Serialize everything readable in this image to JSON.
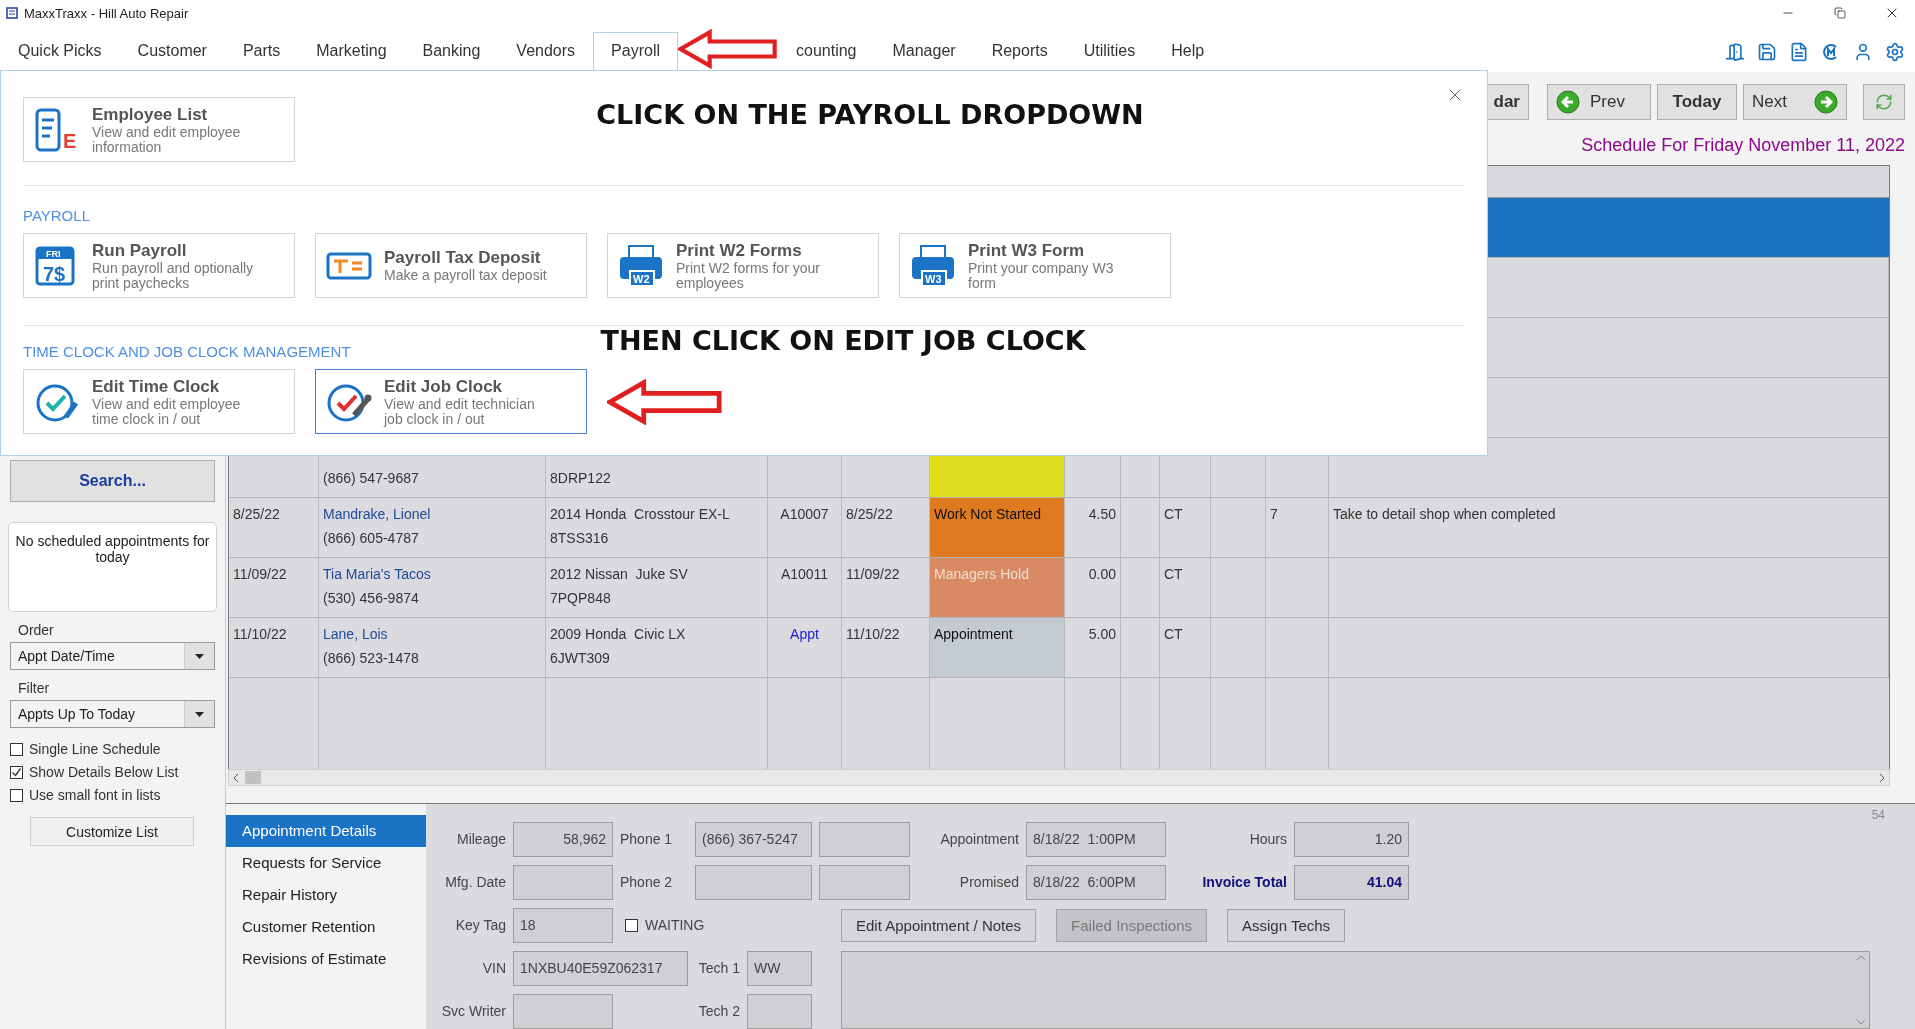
{
  "window": {
    "title": "MaxxTraxx - Hill Auto Repair"
  },
  "menu": [
    {
      "label": "Quick Picks",
      "selected": false
    },
    {
      "label": "Customer",
      "selected": false
    },
    {
      "label": "Parts",
      "selected": false
    },
    {
      "label": "Marketing",
      "selected": false
    },
    {
      "label": "Banking",
      "selected": false
    },
    {
      "label": "Vendors",
      "selected": false
    },
    {
      "label": "Payroll",
      "selected": true
    },
    {
      "label": "counting",
      "selected": false
    },
    {
      "label": "Manager",
      "selected": false
    },
    {
      "label": "Reports",
      "selected": false
    },
    {
      "label": "Utilities",
      "selected": false
    },
    {
      "label": "Help",
      "selected": false
    }
  ],
  "payroll_menu": {
    "top": {
      "note": "CLICK ON THE PAYROLL DROPDOWN",
      "tiles": [
        {
          "title": "Employee List",
          "description": "View and edit employee information",
          "icon_text": [
            "E"
          ],
          "selected": false
        }
      ]
    },
    "sections": [
      {
        "heading": "PAYROLL",
        "tiles": [
          {
            "title": "Run Payroll",
            "description": "Run payroll and optionally print paychecks",
            "icon_text": [
              "FRI",
              "7$"
            ],
            "selected": false
          },
          {
            "title": "Payroll Tax Deposit",
            "description": "Make a payroll tax deposit",
            "selected": false
          },
          {
            "title": "Print W2 Forms",
            "description": "Print W2 forms for your employees",
            "icon_text": [
              "W2"
            ],
            "selected": false
          },
          {
            "title": "Print W3 Form",
            "description": "Print your company W3 form",
            "icon_text": [
              "W3"
            ],
            "selected": false
          }
        ]
      },
      {
        "heading": "TIME CLOCK AND JOB CLOCK MANAGEMENT",
        "note": "THEN CLICK ON EDIT JOB CLOCK",
        "tiles": [
          {
            "title": "Edit Time Clock",
            "description": "View and edit employee time clock in / out",
            "selected": false
          },
          {
            "title": "Edit Job Clock",
            "description": "View and edit technician job clock in / out",
            "selected": true
          }
        ]
      }
    ]
  },
  "toolbar": [
    {
      "kind": "plain",
      "label": "dar"
    },
    {
      "kind": "prev",
      "label": "Prev"
    },
    {
      "kind": "today",
      "label": "Today"
    },
    {
      "kind": "next",
      "label": "Next"
    },
    {
      "kind": "refresh"
    }
  ],
  "schedule_title": "Schedule For Friday November 11, 2022",
  "sidebar": {
    "search_button": "Search...",
    "notice": "No scheduled appointments for today",
    "order": {
      "label": "Order",
      "value": "Appt Date/Time"
    },
    "filter": {
      "label": "Filter",
      "value": "Appts Up To Today"
    },
    "options": [
      {
        "label": "Single Line Schedule",
        "checked": false
      },
      {
        "label": "Show Details Below List",
        "checked": true
      },
      {
        "label": "Use small font in lists",
        "checked": false
      }
    ],
    "customize_button": "Customize List"
  },
  "table": {
    "rows": [
      {
        "selected": true
      },
      {
        "selected": false
      },
      {
        "selected": false
      },
      {
        "selected": false
      },
      {
        "selected": false,
        "phone": "(866) 547-9687",
        "plate": "8DRP122",
        "color": "#dede1e"
      },
      {
        "selected": false,
        "date": "8/25/22",
        "customer": "Mandrake, Lionel",
        "phone": "(866) 605-4787",
        "vehicle": "2014 Honda  Crosstour EX-L",
        "plate": "8TSS316",
        "ro": "A10007",
        "ro_link": false,
        "promised": "8/25/22",
        "status": "Work Not Started",
        "status_dimmed": false,
        "color": "#e07a1f",
        "hours": "4.50",
        "tech": "CT",
        "column_11": "7",
        "notes": "Take to detail shop when completed"
      },
      {
        "selected": false,
        "date": "11/09/22",
        "customer": "Tia Maria's Tacos",
        "phone": "(530) 456-9874",
        "vehicle": "2012 Nissan  Juke SV",
        "plate": "7PQP848",
        "ro": "A10011",
        "ro_link": false,
        "promised": "11/09/22",
        "status": "Managers Hold",
        "status_dimmed": true,
        "color": "#d78a63",
        "hours": "0.00",
        "tech": "CT"
      },
      {
        "selected": false,
        "date": "11/10/22",
        "customer": "Lane, Lois",
        "phone": "(866) 523-1478",
        "vehicle": "2009 Honda  Civic LX",
        "plate": "6JWT309",
        "ro": "Appt",
        "ro_link": true,
        "promised": "11/10/22",
        "status": "Appointment",
        "status_dimmed": false,
        "color": "#c3cbd0",
        "hours": "5.00",
        "tech": "CT"
      }
    ]
  },
  "details": {
    "counter": "54",
    "nav": [
      {
        "label": "Appointment Details",
        "selected": true
      },
      {
        "label": "Requests for Service",
        "selected": false
      },
      {
        "label": "Repair History",
        "selected": false
      },
      {
        "label": "Customer Retention",
        "selected": false
      },
      {
        "label": "Revisions of Estimate",
        "selected": false
      }
    ],
    "mileage": {
      "label": "Mileage",
      "value": "58,962"
    },
    "phone_1": {
      "label": "Phone 1",
      "value": "(866) 367-5247"
    },
    "appointment": {
      "label": "Appointment",
      "value": "8/18/22  1:00PM"
    },
    "hours": {
      "label": "Hours",
      "value": "1.20"
    },
    "mfg_date": {
      "label": "Mfg. Date"
    },
    "phone_2": {
      "label": "Phone 2"
    },
    "promised": {
      "label": "Promised",
      "value": "8/18/22  6:00PM"
    },
    "invoice_total": {
      "label": "Invoice Total",
      "value": "41.04"
    },
    "key_tag": {
      "label": "Key Tag",
      "value": "18"
    },
    "waiting": {
      "label": "WAITING",
      "checked": false
    },
    "buttons": [
      {
        "label": "Edit Appointment / Notes",
        "disabled": false
      },
      {
        "label": "Failed Inspections",
        "disabled": true
      },
      {
        "label": "Assign Techs",
        "disabled": false
      }
    ],
    "vin": {
      "label": "VIN",
      "value": "1NXBU40E59Z062317"
    },
    "tech_1": {
      "label": "Tech 1",
      "value": "WW"
    },
    "svc_writer": {
      "label": "Svc Writer"
    },
    "tech_2": {
      "label": "Tech 2"
    }
  }
}
